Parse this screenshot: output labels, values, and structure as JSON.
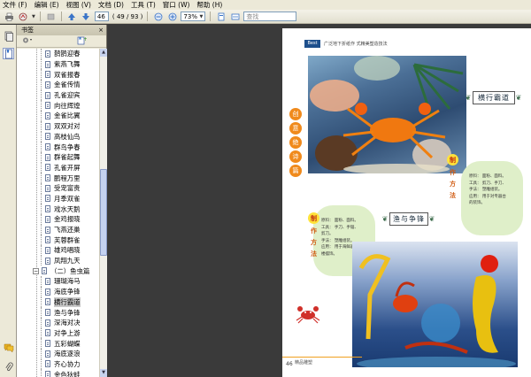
{
  "menu": [
    "文件 (F)",
    "编辑 (E)",
    "视图 (V)",
    "文档 (D)",
    "工具 (T)",
    "窗口 (W)",
    "帮助 (H)"
  ],
  "toolbar": {
    "page_number": "46",
    "page_total": "( 49 / 93 )",
    "zoom": "73%",
    "search_placeholder": "查找"
  },
  "bookmarks": {
    "title": "书签",
    "close": "×",
    "items_before": [
      "鹊鹊迎春",
      "紫燕飞舞",
      "双雀报春",
      "金雀传情",
      "孔雀迎宾",
      "向往辉煌",
      "金雀比翼",
      "双双对对",
      "高枝仙鸟",
      "群鸟争春",
      "群雀起舞",
      "孔雀开屏",
      "鹏程万里",
      "受宠富贵",
      "月季双雀",
      "戏水天鹅",
      "金鸡报晓",
      "飞燕还巢",
      "芙蓉群雀",
      "雄鸡唱晓",
      "凤翔九天"
    ],
    "section": "（二）鱼虫篇",
    "items_after": [
      "珊瑚海马",
      "海底争锋",
      "横行霸道",
      "渔与争锋",
      "深海对决",
      "对争上游",
      "五彩蝴蝶",
      "海底逐浪",
      "齐心协力",
      "金色狄蛙"
    ],
    "selected": "横行霸道"
  },
  "page": {
    "header_title": "广泛地下折纸作  式精美塑造技法",
    "logo": "Best",
    "vertical_title": [
      "创",
      "意",
      "绝",
      "诗",
      "篇"
    ],
    "title1": "横行霸道",
    "title2": "渔与争锋",
    "zhizuo": [
      "制",
      "作",
      "方",
      "法"
    ],
    "info1": [
      "原料：  面粉、面料。",
      "工具：  剪刀、手刀、",
      "手法：  塑雕组装。",
      "应用：  用于对专器台",
      "         的装饰。"
    ],
    "info2": [
      "原料：  面粉、面料。",
      "工具：  手刀、手锯、",
      "         剪刀。",
      "手法：  塑雕组装。",
      "应用：  用于海鲜器",
      "         楼摆饰。"
    ],
    "page_number": "46",
    "footer_brand": "精品雕塑"
  }
}
